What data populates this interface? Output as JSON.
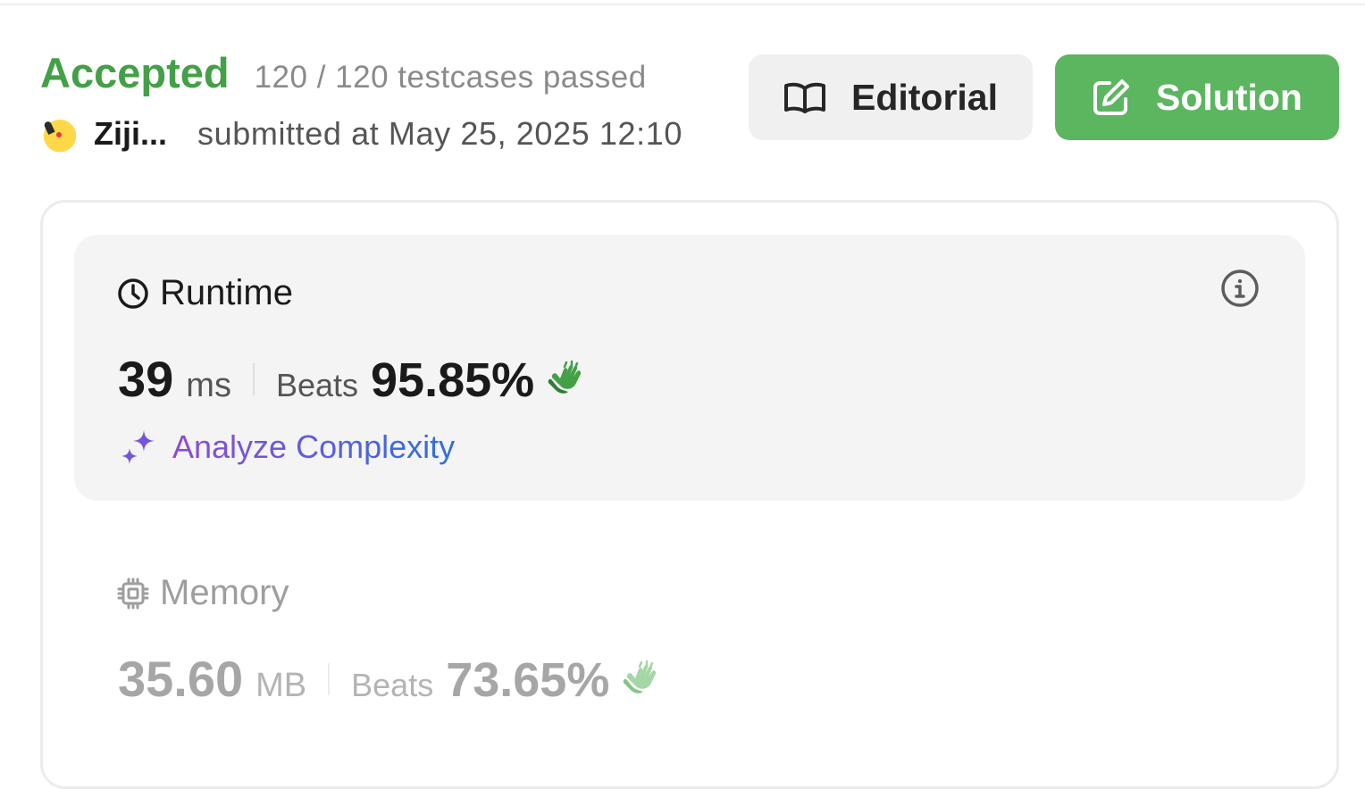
{
  "submission": {
    "status": "Accepted",
    "testcases": "120 / 120 testcases passed",
    "username": "Ziji...",
    "submitted_at": "submitted at May 25, 2025 12:10"
  },
  "buttons": {
    "editorial": "Editorial",
    "solution": "Solution"
  },
  "runtime": {
    "title": "Runtime",
    "value": "39",
    "unit": "ms",
    "beats_label": "Beats",
    "beats_pct": "95.85%",
    "analyze_label": "Analyze Complexity"
  },
  "memory": {
    "title": "Memory",
    "value": "35.60",
    "unit": "MB",
    "beats_label": "Beats",
    "beats_pct": "73.65%"
  },
  "icons": {
    "editorial": "book-open-icon",
    "solution": "edit-square-icon",
    "runtime": "clock-icon",
    "memory": "cpu-chip-icon",
    "info": "info-icon",
    "clap": "clapping-hands-icon",
    "analyze": "sparkles-icon"
  },
  "colors": {
    "accepted": "#43a047",
    "solution_button": "#5cb660",
    "clap_active": "#43a047",
    "clap_muted": "#a5d6a7"
  }
}
